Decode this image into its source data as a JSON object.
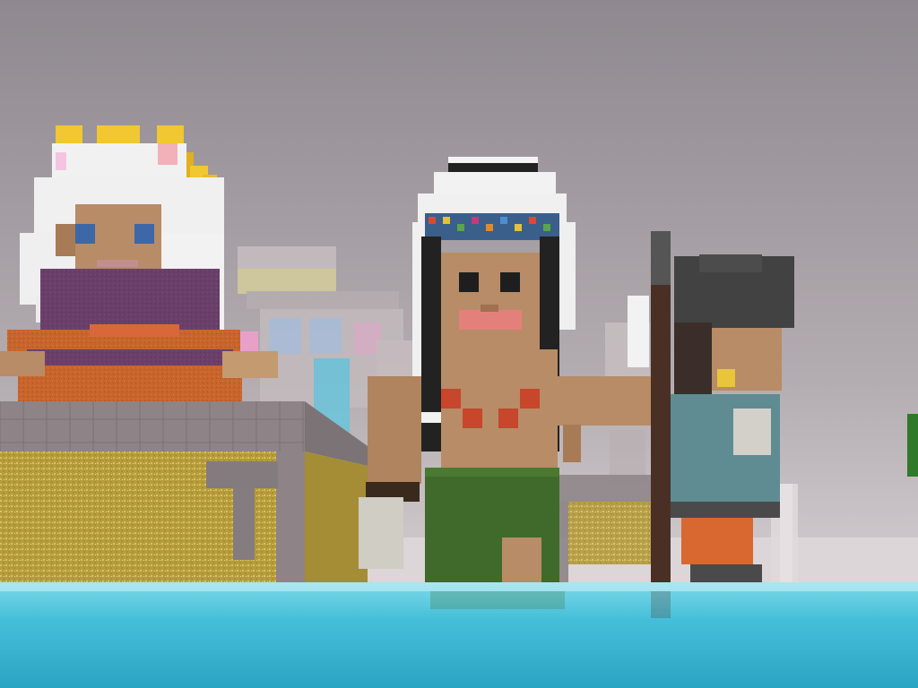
{
  "scene": {
    "name": "voxel-village-waterfront",
    "view": "first-person",
    "colors": {
      "sky_top": "#8f8890",
      "sky_mid": "#b3acb0",
      "sky_bottom": "#e4dde0",
      "water_light": "#7fd9ea",
      "water": "#45bfd9",
      "water_deep": "#2aa4c3",
      "stone": "#8e8487",
      "stone_dark": "#6f676a",
      "sand": "#c9b04a",
      "grass_skirt": "#3f6a2b",
      "skin": "#b88c66",
      "skin_dark": "#a77b56",
      "hair_white": "#f1f1f1",
      "hair_black": "#222222",
      "spear_wood": "#4a3024",
      "crown_gold": "#f1c732",
      "robe_purple": "#6a3f6a",
      "robe_orange": "#c8652c",
      "shirt_teal": "#5e8c92",
      "pants_orange": "#d8682f"
    },
    "characters": [
      {
        "role": "queen",
        "hair": "white",
        "accessory": "gold-crown",
        "outfit": "purple-orange-robe"
      },
      {
        "role": "warrior",
        "hair": "black-with-white-headdress",
        "accessory": "spear",
        "outfit": "green-grass-skirt"
      },
      {
        "role": "villager",
        "hair": "dark",
        "accessory": "earring",
        "outfit": "teal-shirt"
      }
    ]
  }
}
